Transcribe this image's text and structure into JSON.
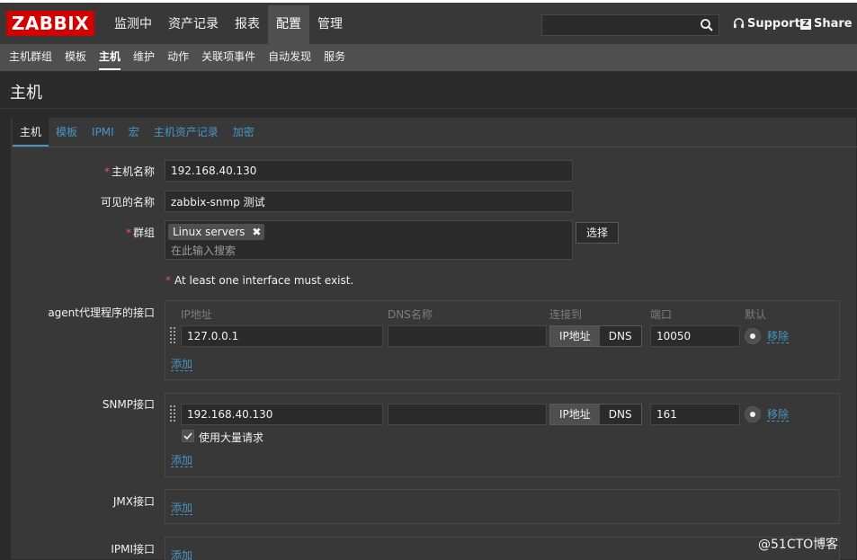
{
  "brand": {
    "logo": "ZABBIX"
  },
  "main_menu": [
    {
      "label": "监测中",
      "active": false
    },
    {
      "label": "资产记录",
      "active": false
    },
    {
      "label": "报表",
      "active": false
    },
    {
      "label": "配置",
      "active": true
    },
    {
      "label": "管理",
      "active": false
    }
  ],
  "search": {
    "value": "",
    "icon": "search-icon"
  },
  "support": {
    "label": "Support",
    "icon": "headset-icon"
  },
  "share": {
    "label": "Share",
    "icon_letter": "Z"
  },
  "sub_menu": [
    {
      "label": "主机群组",
      "active": false
    },
    {
      "label": "模板",
      "active": false
    },
    {
      "label": "主机",
      "active": true
    },
    {
      "label": "维护",
      "active": false
    },
    {
      "label": "动作",
      "active": false
    },
    {
      "label": "关联项事件",
      "active": false
    },
    {
      "label": "自动发现",
      "active": false
    },
    {
      "label": "服务",
      "active": false
    }
  ],
  "page_title": "主机",
  "tabs": [
    {
      "label": "主机",
      "active": true
    },
    {
      "label": "模板",
      "active": false
    },
    {
      "label": "IPMI",
      "active": false
    },
    {
      "label": "宏",
      "active": false
    },
    {
      "label": "主机资产记录",
      "active": false
    },
    {
      "label": "加密",
      "active": false
    }
  ],
  "form": {
    "required_mark": "*",
    "host_name": {
      "label": "主机名称",
      "value": "192.168.40.130"
    },
    "visible_name": {
      "label": "可见的名称",
      "value": "zabbix-snmp 测试"
    },
    "groups": {
      "label": "群组",
      "chip": "Linux servers",
      "chip_remove": "✖",
      "placeholder": "在此输入搜索",
      "select_button": "选择"
    },
    "warning": "At least one interface must exist.",
    "columns": {
      "ip": "IP地址",
      "dns": "DNS名称",
      "connect": "连接到",
      "port": "端口",
      "default": "默认"
    },
    "agent": {
      "label": "agent代理程序的接口",
      "ip": "127.0.0.1",
      "dns": "",
      "connect_ip": "IP地址",
      "connect_dns": "DNS",
      "connect_selected": "IP地址",
      "port": "10050",
      "remove": "移除",
      "add": "添加"
    },
    "snmp": {
      "label": "SNMP接口",
      "ip": "192.168.40.130",
      "dns": "",
      "connect_ip": "IP地址",
      "connect_dns": "DNS",
      "connect_selected": "IP地址",
      "port": "161",
      "remove": "移除",
      "bulk_label": "使用大量请求",
      "bulk_checked": true,
      "add": "添加"
    },
    "jmx": {
      "label": "JMX接口",
      "add": "添加"
    },
    "ipmi": {
      "label": "IPMI接口",
      "add": "添加"
    }
  },
  "watermark": "@51CTO博客",
  "colors": {
    "accent": "#4796c4",
    "brand_red": "#d40000",
    "required": "#e45959",
    "background": "#2b2b2b",
    "panel": "#383838"
  }
}
